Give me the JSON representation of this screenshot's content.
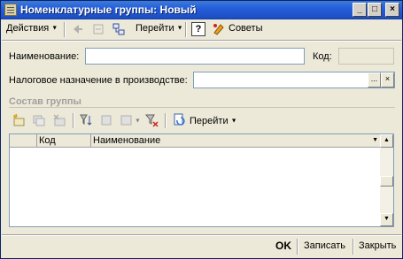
{
  "window": {
    "title": "Номенклатурные группы: Новый",
    "min_glyph": "_",
    "max_glyph": "□",
    "close_glyph": "×"
  },
  "toolbar": {
    "actions_label": "Действия",
    "goto_label": "Перейти",
    "help_glyph": "?",
    "tips_label": "Советы"
  },
  "form": {
    "name_label": "Наименование:",
    "name_value": "",
    "code_label": "Код:",
    "code_value": "",
    "tax_label": "Налоговое назначение в производстве:",
    "tax_value": "",
    "select_glyph": "...",
    "clear_glyph": "×"
  },
  "group": {
    "section_title": "Состав группы",
    "goto_label": "Перейти",
    "columns": [
      "Код",
      "Наименование"
    ],
    "rows": []
  },
  "footer": {
    "ok_label": "OK",
    "save_label": "Записать",
    "close_label": "Закрыть"
  },
  "colors": {
    "titlebar": "#245edb",
    "window_bg": "#ece9d8",
    "field_border": "#7f9db9"
  }
}
